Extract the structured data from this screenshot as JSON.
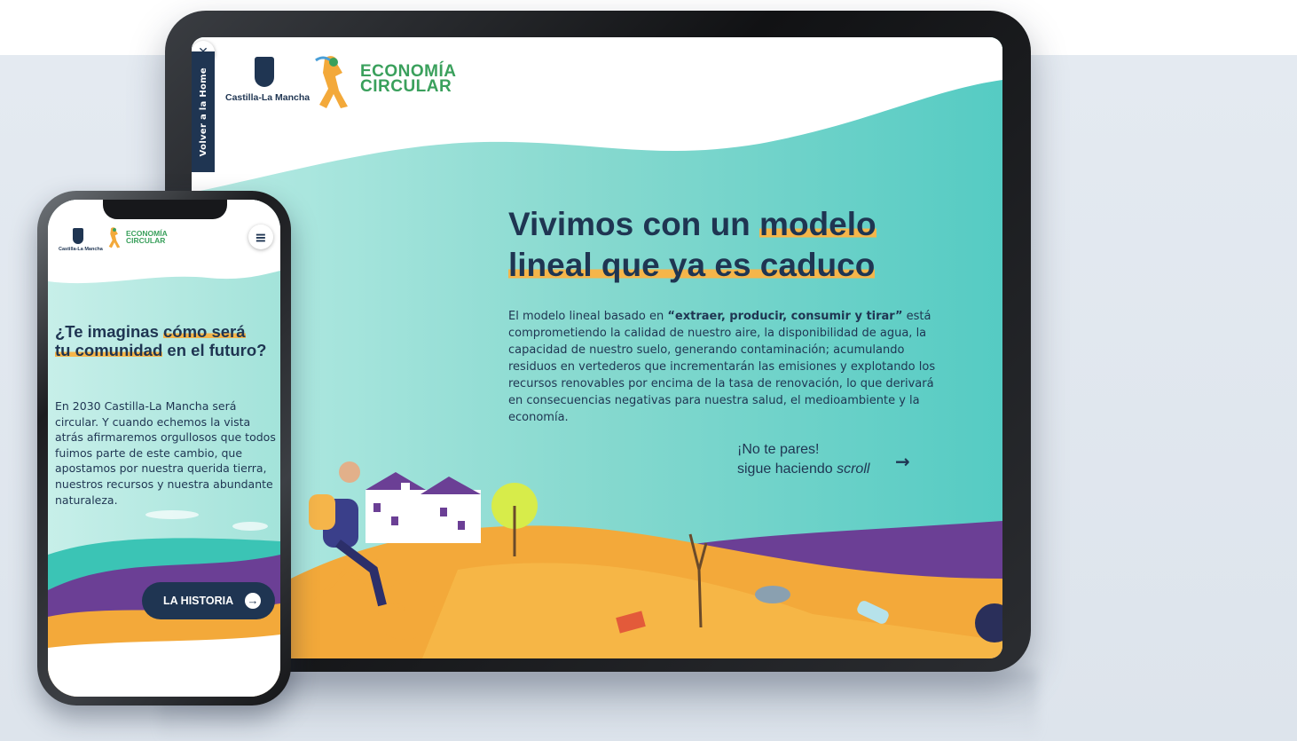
{
  "tablet": {
    "close_symbol": "✕",
    "back_label": "Volver a la Home",
    "jccm_label": "Castilla-La Mancha",
    "brand_line1": "ECONOMÍA",
    "brand_line2": "CIRCULAR",
    "title_part1": "Vivimos con un ",
    "title_highlight1": "modelo",
    "title_highlight2": "lineal que ya es caduco",
    "body_part1": "El modelo lineal basado en ",
    "body_bold": "“extraer, producir, consumir y tirar”",
    "body_part2": " está comprometiendo la calidad de nuestro aire, la disponibilidad de agua, la capacidad de nuestro suelo, generando contaminación; acumulando residuos en vertederos que incrementarán las emisiones y explotando los recursos renovables por encima de la tasa de renovación, lo que derivará en consecuencias negativas para nuestra salud, el medioambiente y la economía.",
    "scroll_line1": "¡No te pares!",
    "scroll_line2": "sigue haciendo ",
    "scroll_italic": "scroll",
    "arrow_symbol": "→"
  },
  "phone": {
    "jccm_label": "Castilla-La Mancha",
    "brand_line1": "ECONOMÍA",
    "brand_line2": "CIRCULAR",
    "menu_symbol": "≡",
    "title_part1": "¿Te imaginas ",
    "title_highlight1": "cómo será",
    "title_highlight2": "tu comunidad",
    "title_part2": " en el futuro?",
    "body": "En 2030 Castilla-La Mancha será circular. Y cuando echemos la vista atrás afirmaremos orgullosos que todos fuimos parte de este cambio, que apostamos por nuestra querida tierra, nuestros recursos y nuestra abundante naturaleza.",
    "button_label": "LA HISTORIA",
    "button_icon": "→"
  },
  "colors": {
    "navy": "#1f3552",
    "teal": "#8fdcd2",
    "orange": "#f3a93a",
    "purple": "#6a3e93",
    "green_brand": "#3aa05c",
    "highlight": "#f5b54a"
  }
}
